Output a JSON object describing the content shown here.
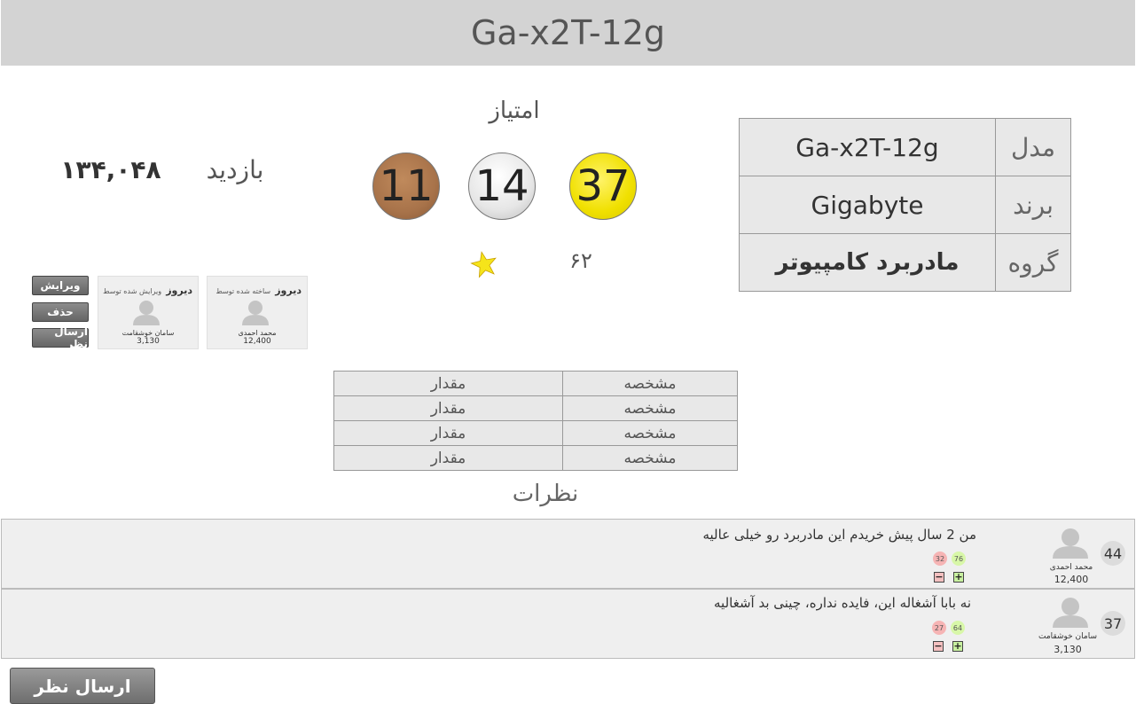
{
  "header": {
    "title": "Ga-x2T-12g"
  },
  "info": {
    "rows": [
      {
        "label": "مدل",
        "value": "Ga-x2T-12g"
      },
      {
        "label": "برند",
        "value": "Gigabyte"
      },
      {
        "label": "گروه",
        "value": "مادربرد کامپیوتر"
      }
    ]
  },
  "score": {
    "title": "امتیاز",
    "gold": "37",
    "silver": "14",
    "bronze": "11",
    "star_count": "۶۲"
  },
  "visits": {
    "label": "بازدید",
    "count": "۱۳۴,۰۴۸"
  },
  "creator_card": {
    "date": "دیروز",
    "caption": "ساخته شده توسط",
    "name": "محمد احمدی",
    "points": "12,400"
  },
  "editor_card": {
    "date": "دیروز",
    "caption": "ویرایش شده توسط",
    "name": "سامان خوشقامت",
    "points": "3,130"
  },
  "actions": {
    "edit": "ویرایش",
    "delete": "حذف",
    "comment": "ارسال نظر"
  },
  "specs": {
    "rows": [
      {
        "key": "مشخصه",
        "value": "مقدار"
      },
      {
        "key": "مشخصه",
        "value": "مقدار"
      },
      {
        "key": "مشخصه",
        "value": "مقدار"
      },
      {
        "key": "مشخصه",
        "value": "مقدار"
      }
    ]
  },
  "comments": {
    "title": "نظرات",
    "items": [
      {
        "score": "44",
        "text": "من 2 سال پیش خریدم این مادربرد رو خیلی عالیه",
        "user": "محمد احمدی",
        "points": "12,400",
        "up": "76",
        "down": "32",
        "plus": "+",
        "minus": "−"
      },
      {
        "score": "37",
        "text": "نه بابا آشغاله این، فایده نداره، چینی بد آشغالیه",
        "user": "سامان خوشقامت",
        "points": "3,130",
        "up": "64",
        "down": "27",
        "plus": "+",
        "minus": "−"
      }
    ]
  },
  "submit_comment": "ارسال نظر",
  "colors": {
    "header_bg": "#d3d3d3",
    "gold": "#f0e000",
    "silver": "#e6e6e6",
    "bronze": "#a8734a",
    "star": "#f5e41a"
  }
}
